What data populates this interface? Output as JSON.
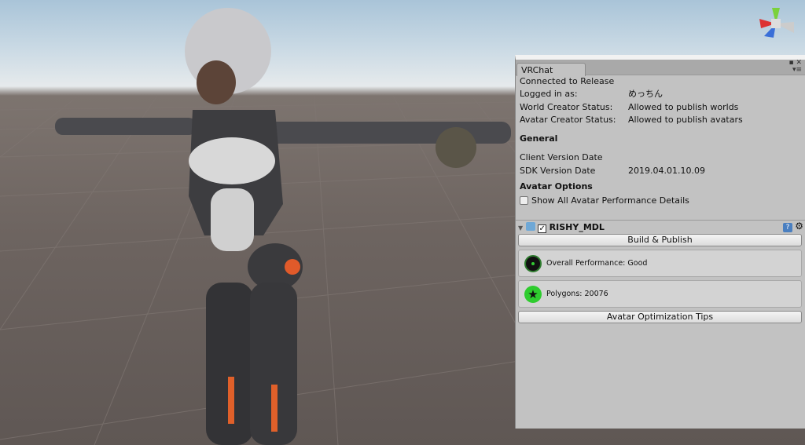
{
  "window": {
    "tab": "VRChat"
  },
  "status": {
    "connected": "Connected to Release",
    "rows": [
      {
        "label": "Logged in as:",
        "value": "めっちん"
      },
      {
        "label": "World Creator Status:",
        "value": "Allowed to publish worlds"
      },
      {
        "label": "Avatar Creator Status:",
        "value": "Allowed to publish avatars"
      }
    ]
  },
  "general": {
    "heading": "General",
    "client_version_label": "Client Version Date",
    "sdk_version_label": "SDK Version Date",
    "sdk_version_value": "2019.04.01.10.09"
  },
  "avatar_options": {
    "heading": "Avatar Options",
    "show_details_label": "Show All Avatar Performance Details",
    "show_details_checked": false
  },
  "component": {
    "name": "RISHY_MDL",
    "enabled": true,
    "build_button": "Build & Publish",
    "overall": "Overall Performance: Good",
    "polygons": "Polygons: 20076",
    "tips_button": "Avatar Optimization Tips"
  },
  "colors": {
    "good": "#1a1a1a",
    "excellent": "#2ecc2e"
  }
}
